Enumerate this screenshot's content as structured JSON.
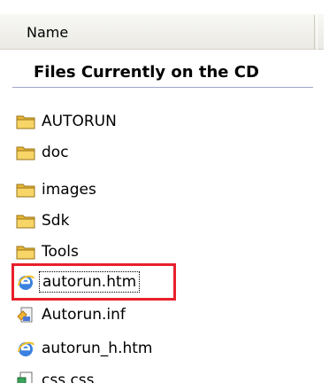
{
  "header": {
    "column_name": "Name"
  },
  "group": {
    "title": "Files Currently on the CD"
  },
  "files": [
    {
      "label": "AUTORUN",
      "icon": "folder-icon",
      "selected": false
    },
    {
      "label": "doc",
      "icon": "folder-icon",
      "selected": false
    },
    {
      "label": "images",
      "icon": "folder-icon",
      "selected": false
    },
    {
      "label": "Sdk",
      "icon": "folder-icon",
      "selected": false
    },
    {
      "label": "Tools",
      "icon": "folder-icon",
      "selected": false
    },
    {
      "label": "autorun.htm",
      "icon": "ie-html-icon",
      "selected": true
    },
    {
      "label": "Autorun.inf",
      "icon": "setup-info-icon",
      "selected": false
    },
    {
      "label": "autorun_h.htm",
      "icon": "ie-html-icon",
      "selected": false
    },
    {
      "label": "css.css",
      "icon": "css-file-icon",
      "selected": false
    }
  ],
  "colors": {
    "highlight_border": "#e8202a",
    "folder": "#f2c94c"
  }
}
